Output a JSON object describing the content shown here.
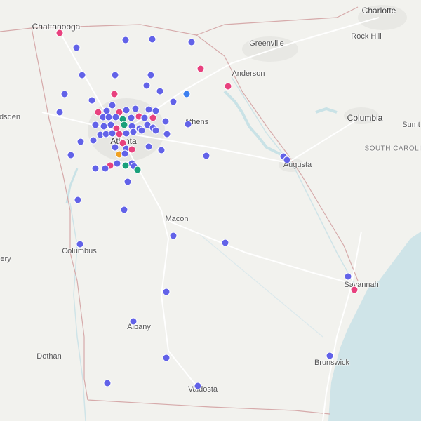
{
  "colors": {
    "land": "#f2f2ee",
    "water": "#c9e2e6",
    "ocean": "#cfe4e8",
    "urban": "#e6e6e2",
    "border": "#d6aaaa",
    "marker_default": "#6262e8",
    "marker_pink": "#e8417e",
    "marker_green": "#1aa07a",
    "marker_blue": "#3c7ff0",
    "marker_orange": "#f0a020"
  },
  "cities": {
    "charlotte": "Charlotte",
    "chattanooga": "Chattanooga",
    "greenville": "Greenville",
    "rock_hill": "Rock Hill",
    "anderson": "Anderson",
    "gadsden": "dsden",
    "athens": "Athens",
    "columbia": "Columbia",
    "sumter": "Sumt",
    "atlanta": "Atlanta",
    "south_carolina": "SOUTH CAROLI",
    "augusta": "Augusta",
    "macon": "Macon",
    "columbus": "Columbus",
    "montgomery": "ery",
    "savannah": "Savannah",
    "albany": "Albany",
    "dothan": "Dothan",
    "brunswick": "Brunswick",
    "valdosta": "Valdosta"
  }
}
